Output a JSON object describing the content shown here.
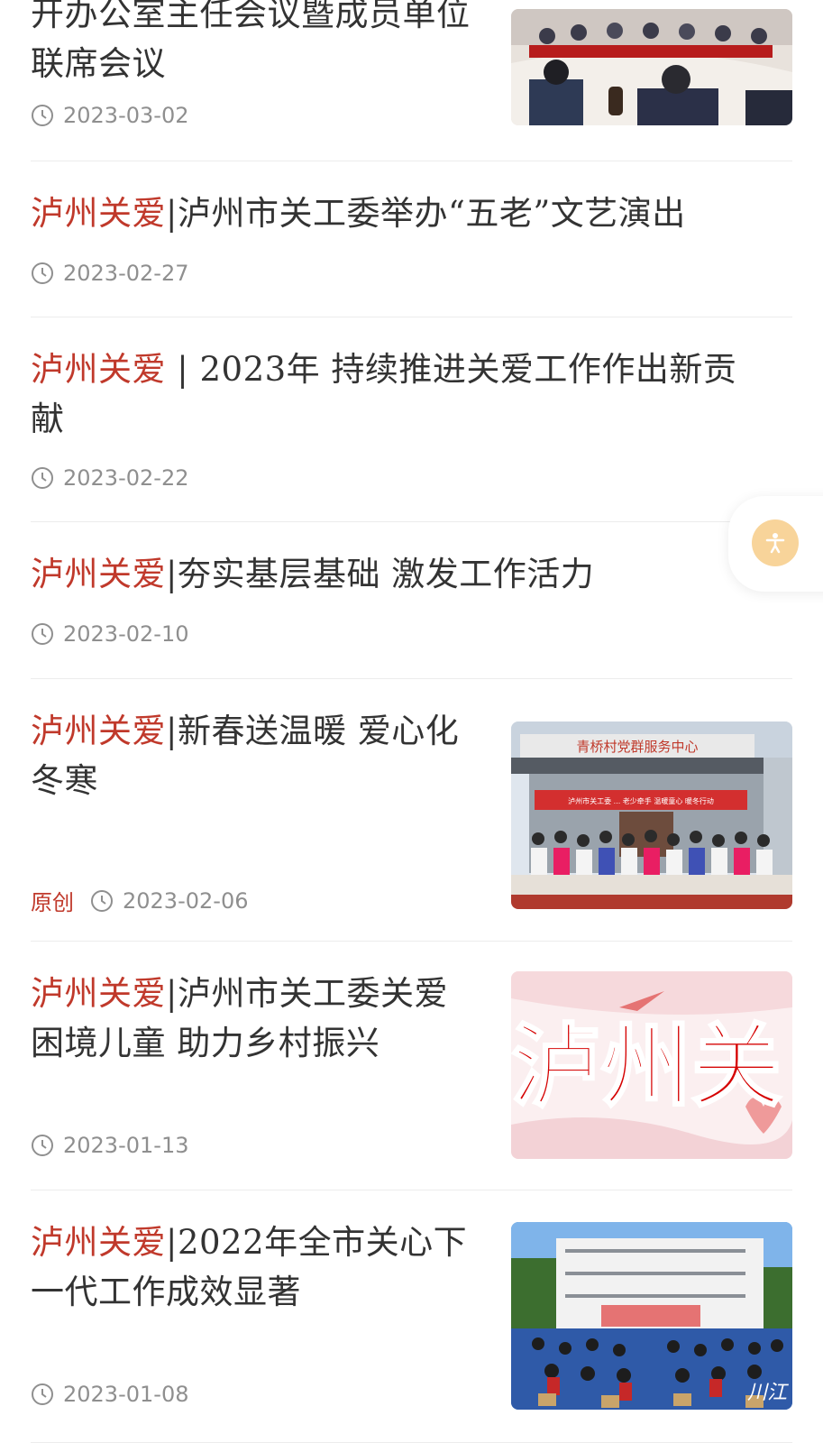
{
  "articles": [
    {
      "title_lines": "开办公室主任会议暨成员单位联席会议",
      "date": "2023-03-02",
      "image": "meeting-photo"
    },
    {
      "tag": "泸州关爱",
      "title": "|泸州市关工委举办“五老”文艺演出",
      "date": "2023-02-27"
    },
    {
      "tag": "泸州关爱",
      "title": " | 2023年 持续推进关爱工作作出新贡献",
      "date": "2023-02-22"
    },
    {
      "tag": "泸州关爱",
      "title": "|夯实基层基础 激发工作活力",
      "date": "2023-02-10"
    },
    {
      "tag": "泸州关爱",
      "title": "|新春送温暖 爱心化冬寒",
      "original_label": "原创",
      "date": "2023-02-06",
      "image": "service-center-group-photo",
      "image_sign": "青桥村党群服务中心",
      "image_banner": "泸州市关工委 ... 老少牵手 温暖童心 暖冬行动"
    },
    {
      "tag": "泸州关爱",
      "title": "|泸州市关工委关爱困境儿童 助力乡村振兴",
      "date": "2023-01-13",
      "image": "luzhou-guanai-banner",
      "image_text": "泸州关"
    },
    {
      "tag": "泸州关爱",
      "title": "|2022年全市关心下一代工作成效显著",
      "date": "2023-01-08",
      "image": "school-assembly-photo",
      "image_watermark": "川江"
    }
  ],
  "colors": {
    "tag_red": "#c0392b",
    "text": "#333333",
    "meta": "#8f8f8f",
    "accessibility": "#f8d49a"
  },
  "icons": {
    "clock": "clock-icon",
    "accessibility": "accessibility-icon"
  }
}
